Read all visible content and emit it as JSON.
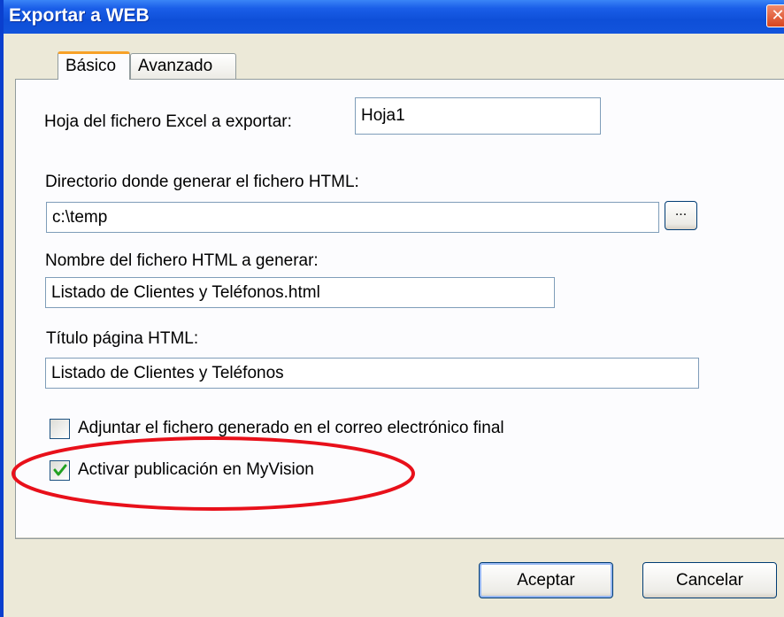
{
  "window": {
    "title": "Exportar a WEB",
    "close_glyph": "✕"
  },
  "tabs": [
    {
      "label": "Básico",
      "active": true
    },
    {
      "label": "Avanzado",
      "active": false
    }
  ],
  "form": {
    "sheet_label": "Hoja del fichero Excel a exportar:",
    "sheet_value": "Hoja1",
    "directory_label": "Directorio donde generar el fichero HTML:",
    "directory_value": "c:\\temp",
    "browse_label": "...",
    "filename_label": "Nombre del fichero HTML a generar:",
    "filename_value": "Listado de Clientes y Teléfonos.html",
    "page_title_label": "Título página HTML:",
    "page_title_value": "Listado de Clientes y Teléfonos",
    "attach_label": "Adjuntar el fichero generado en el correo electrónico final",
    "attach_checked": false,
    "publish_label": "Activar publicación en MyVision",
    "publish_checked": true
  },
  "buttons": {
    "accept_label": "Aceptar",
    "cancel_label": "Cancelar"
  },
  "colors": {
    "titlebar": "#0e4fd8",
    "highlight_annotation": "#e8101a",
    "check_mark": "#21a121"
  }
}
